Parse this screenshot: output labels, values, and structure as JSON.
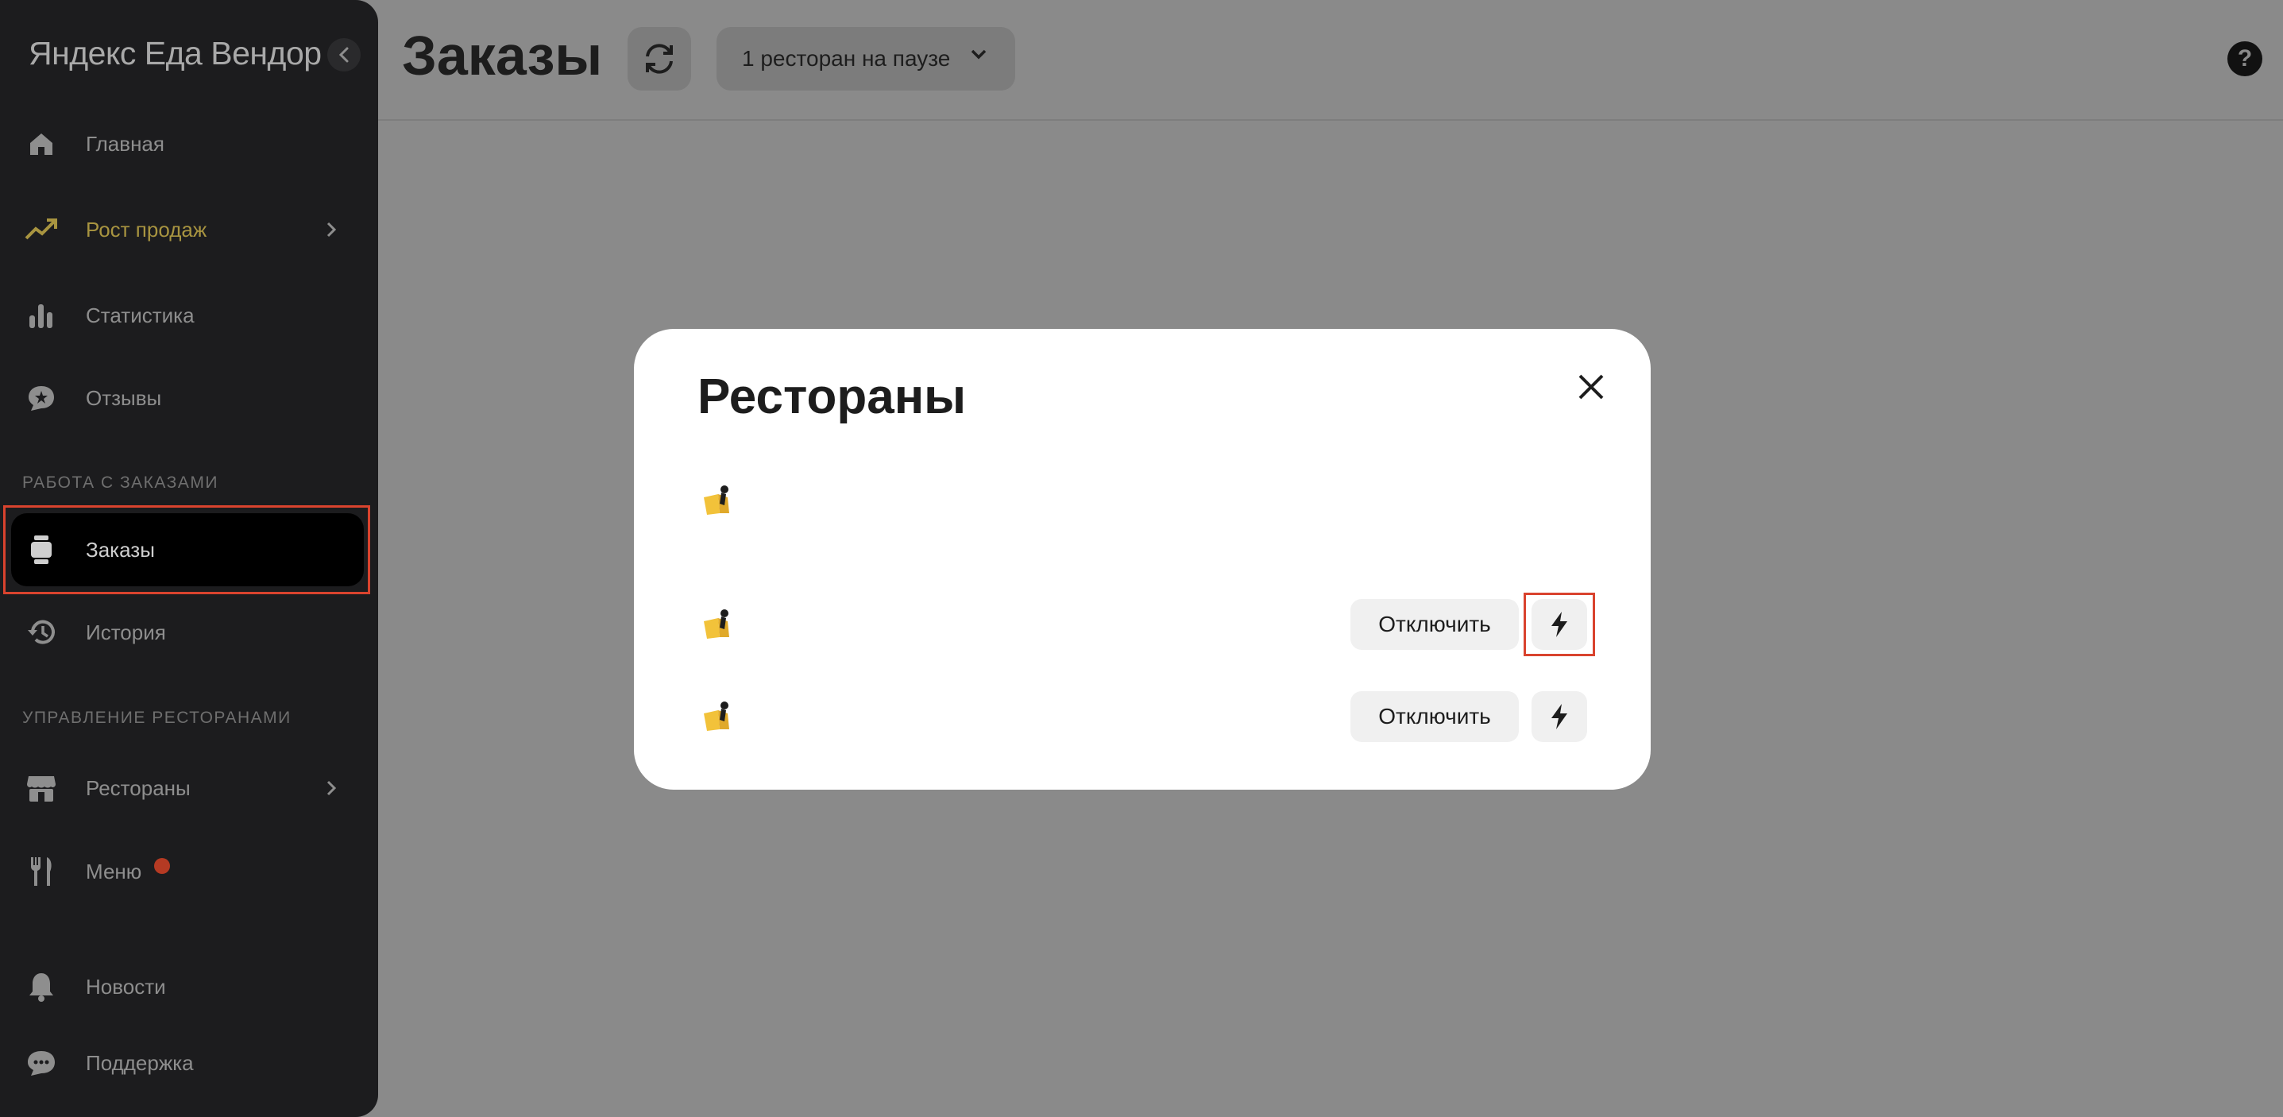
{
  "sidebar": {
    "logo": "Яндекс Еда Вендор",
    "items": [
      {
        "label": "Главная",
        "icon": "home-icon"
      },
      {
        "label": "Рост продаж",
        "icon": "trending-up-icon"
      },
      {
        "label": "Статистика",
        "icon": "bar-chart-icon"
      },
      {
        "label": "Отзывы",
        "icon": "review-bubble-icon"
      },
      {
        "label": "Заказы",
        "icon": "orders-icon"
      },
      {
        "label": "История",
        "icon": "history-icon"
      },
      {
        "label": "Рестораны",
        "icon": "storefront-icon"
      },
      {
        "label": "Меню",
        "icon": "fork-knife-icon"
      },
      {
        "label": "Новости",
        "icon": "bell-icon"
      },
      {
        "label": "Поддержка",
        "icon": "chat-icon"
      }
    ],
    "sections": {
      "orders": "РАБОТА С ЗАКАЗАМИ",
      "restaurants": "УПРАВЛЕНИЕ РЕСТОРАНАМИ"
    },
    "accent_color": "#a89440",
    "badge_color": "#b53a23"
  },
  "header": {
    "title": "Заказы",
    "pause_label": "1 ресторан на паузе"
  },
  "help": {
    "label": "?"
  },
  "modal": {
    "title": "Рестораны",
    "rows": [
      {
        "icon": "restaurant-logo-icon"
      },
      {
        "icon": "restaurant-logo-icon",
        "action_label": "Отключить"
      },
      {
        "icon": "restaurant-logo-icon",
        "action_label": "Отключить"
      }
    ]
  },
  "highlight_color": "#d9432e"
}
